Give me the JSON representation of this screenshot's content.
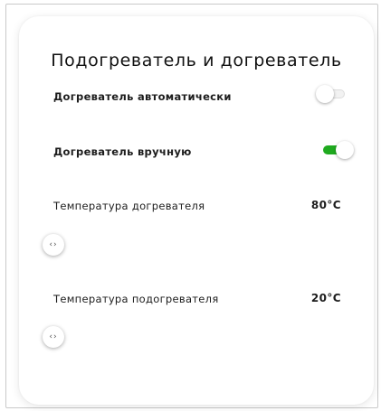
{
  "panel": {
    "title": "Подогреватель и догреватель"
  },
  "settings": {
    "auto_preheater": {
      "label": "Догреватель автоматически",
      "enabled": false
    },
    "manual_preheater": {
      "label": "Догреватель вручную",
      "enabled": true
    },
    "preheater_temperature": {
      "label": "Температура догревателя",
      "value_text": "80°C",
      "slider_level": 0.0
    },
    "heater_temperature": {
      "label": "Температура подогревателя",
      "value_text": "20°C",
      "slider_level": 0.0
    }
  },
  "icons": {
    "slider_thumb_glyph": "‹›"
  },
  "colors": {
    "toggle_on": "#1faa1f",
    "toggle_off": "#f2f2f2",
    "text": "#1c1c1c"
  }
}
